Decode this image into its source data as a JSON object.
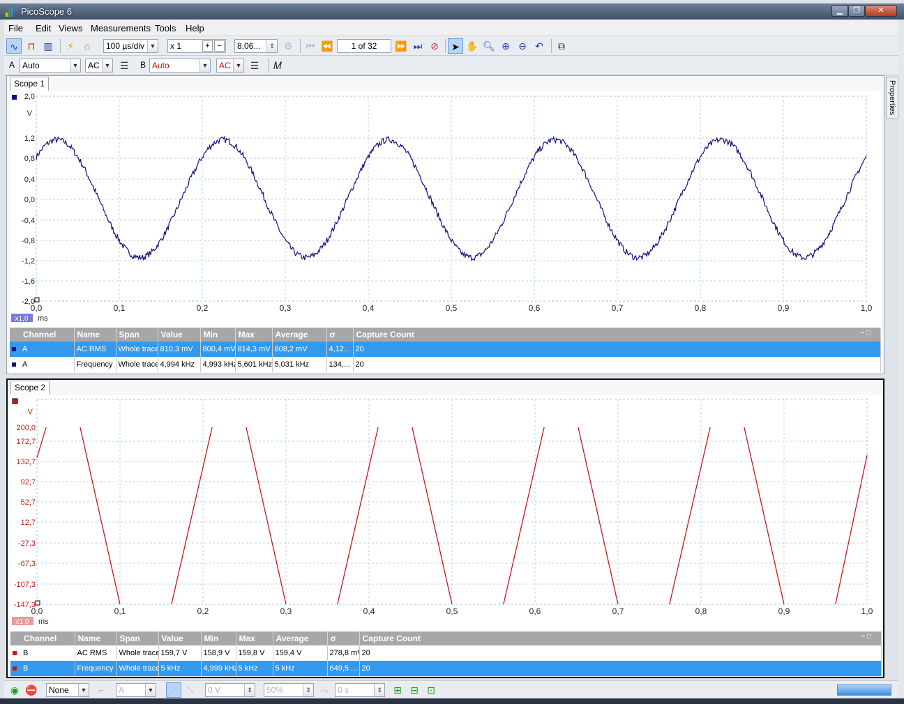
{
  "window": {
    "title": "PicoScope 6"
  },
  "menu": [
    "File",
    "Edit",
    "Views",
    "Measurements",
    "Tools",
    "Help"
  ],
  "toolbar": {
    "timebase": "100 µs/div",
    "zoom": "x 1",
    "samples": "8,06...",
    "buffer": "1 of 32"
  },
  "channels": {
    "a": {
      "label": "A",
      "range": "Auto",
      "coupling": "AC"
    },
    "b": {
      "label": "B",
      "range": "Auto",
      "coupling": "AC"
    }
  },
  "side_tab": "Properties",
  "colors": {
    "channel_a": "#10107a",
    "channel_b": "#c81818",
    "grid": "#b8d4e6",
    "selected_row": "#3399ee"
  },
  "scope1": {
    "tab": "Scope 1",
    "yunit": "V",
    "xunit": "ms",
    "zoom_badge": "x1,0",
    "chart_data": {
      "type": "line",
      "x_ticks": [
        "0,0",
        "0,1",
        "0,2",
        "0,3",
        "0,4",
        "0,5",
        "0,6",
        "0,7",
        "0,8",
        "0,9",
        "1,0"
      ],
      "y_ticks": [
        "2,0",
        "1,2",
        "0,8",
        "0,4",
        "0,0",
        "-0,4",
        "-0,8",
        "-1,2",
        "-1,6",
        "-2,0"
      ],
      "xlim": [
        0,
        1.0
      ],
      "ylim": [
        -2.0,
        2.0
      ],
      "series": [
        {
          "amplitude": 1.15,
          "frequency_khz": 5,
          "phase_deg": 45,
          "noise": 0.06,
          "color": "#10107a"
        }
      ]
    },
    "table": {
      "headers": [
        "Channel",
        "Name",
        "Span",
        "Value",
        "Min",
        "Max",
        "Average",
        "σ",
        "Capture Count"
      ],
      "rows": [
        {
          "selected": true,
          "cells": [
            "A",
            "AC RMS",
            "Whole trace",
            "810,3 mV",
            "800,4 mV",
            "814,3 mV",
            "808,2 mV",
            "4,12...",
            "20"
          ]
        },
        {
          "selected": false,
          "cells": [
            "A",
            "Frequency",
            "Whole trace",
            "4,994 kHz",
            "4,993 kHz",
            "5,601 kHz",
            "5,031 kHz",
            "134,...",
            "20"
          ]
        }
      ]
    }
  },
  "scope2": {
    "tab": "Scope 2",
    "yunit": "V",
    "xunit": "ms",
    "zoom_badge": "x1,0",
    "chart_data": {
      "type": "line",
      "x_ticks": [
        "0,0",
        "0,1",
        "0,2",
        "0,3",
        "0,4",
        "0,5",
        "0,6",
        "0,7",
        "0,8",
        "0,9",
        "1,0"
      ],
      "y_ticks": [
        "200,0",
        "172,7",
        "132,7",
        "92,7",
        "52,7",
        "12,7",
        "-27,3",
        "-67,3",
        "-107,3",
        "-147,3"
      ],
      "xlim": [
        0,
        1.0
      ],
      "ylim": [
        -147.3,
        200.0
      ],
      "series": [
        {
          "color": "#c81818",
          "segments": [
            [
              [
                0.0,
                140
              ],
              [
                0.011,
                200
              ]
            ],
            [
              [
                0.052,
                200
              ],
              [
                0.1,
                -147.3
              ]
            ],
            [
              [
                0.162,
                -147.3
              ],
              [
                0.211,
                200
              ]
            ],
            [
              [
                0.252,
                200
              ],
              [
                0.3,
                -147.3
              ]
            ],
            [
              [
                0.362,
                -147.3
              ],
              [
                0.411,
                200
              ]
            ],
            [
              [
                0.452,
                200
              ],
              [
                0.5,
                -147.3
              ]
            ],
            [
              [
                0.562,
                -147.3
              ],
              [
                0.611,
                200
              ]
            ],
            [
              [
                0.652,
                200
              ],
              [
                0.7,
                -147.3
              ]
            ],
            [
              [
                0.762,
                -147.3
              ],
              [
                0.811,
                200
              ]
            ],
            [
              [
                0.852,
                200
              ],
              [
                0.9,
                -147.3
              ]
            ],
            [
              [
                0.962,
                -147.3
              ],
              [
                1.0,
                145
              ]
            ]
          ]
        }
      ]
    },
    "table": {
      "headers": [
        "Channel",
        "Name",
        "Span",
        "Value",
        "Min",
        "Max",
        "Average",
        "σ",
        "Capture Count"
      ],
      "rows": [
        {
          "selected": false,
          "cells": [
            "B",
            "AC RMS",
            "Whole trace",
            "159,7 V",
            "158,9 V",
            "159,8 V",
            "159,4 V",
            "278,8 mV",
            "20"
          ]
        },
        {
          "selected": true,
          "cells": [
            "B",
            "Frequency",
            "Whole trace",
            "5 kHz",
            "4,999 kHz",
            "5 kHz",
            "5 kHz",
            "649,5 ...",
            "20"
          ]
        }
      ]
    }
  },
  "bottom": {
    "trigger_mode": "None",
    "trigger_source": "A",
    "threshold": "0 V",
    "pretrigger": "50%",
    "delay": "0 s"
  }
}
